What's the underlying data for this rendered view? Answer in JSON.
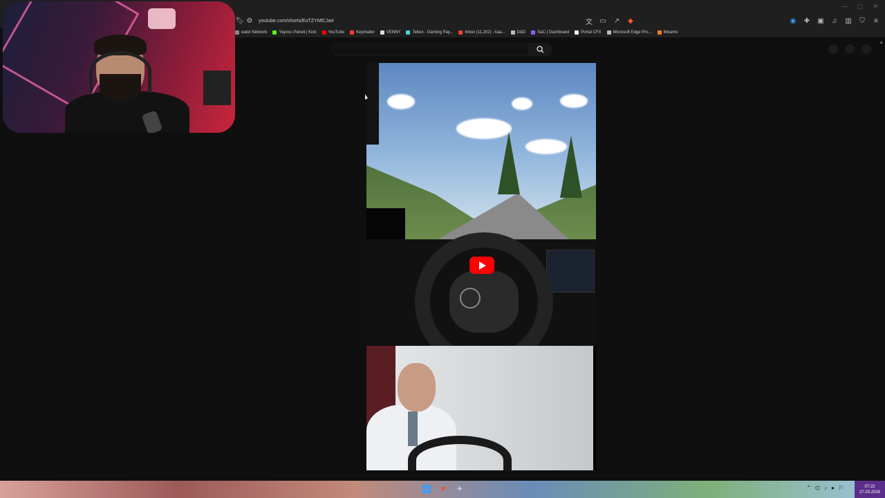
{
  "browser": {
    "url": "youtube.com/shorts/EoTZYMlCJa4",
    "bookmarks": [
      {
        "label": "eator Network",
        "color": "#888888"
      },
      {
        "label": "Yayıncı Paneli | Kick",
        "color": "#53fc18"
      },
      {
        "label": "YouTube",
        "color": "#ff0000"
      },
      {
        "label": "Keymailer",
        "color": "#ff3b3b"
      },
      {
        "label": "VENNY",
        "color": "#dddddd"
      },
      {
        "label": "Tebex - Gaming Pay...",
        "color": "#4ad3d3"
      },
      {
        "label": "Inbox (11,202) - kaa...",
        "color": "#ea4335"
      },
      {
        "label": "D&D",
        "color": "#bbbbbb"
      },
      {
        "label": "SaC | Dashboard",
        "color": "#8a5cf5"
      },
      {
        "label": "Portal CFX",
        "color": "#f5f5f5"
      },
      {
        "label": "Microsoft Edge Pro...",
        "color": "#bbbbbb"
      },
      {
        "label": "Mixamo",
        "color": "#ff7a1a"
      }
    ]
  },
  "youtube": {
    "search_placeholder": "",
    "play_label": "Play"
  },
  "taskbar": {
    "time": "07:22",
    "date": "27.03.2026"
  },
  "colors": {
    "accent_red": "#ff0000",
    "page_bg": "#0f0f0f",
    "clock_bg": "#5a2e8a"
  }
}
